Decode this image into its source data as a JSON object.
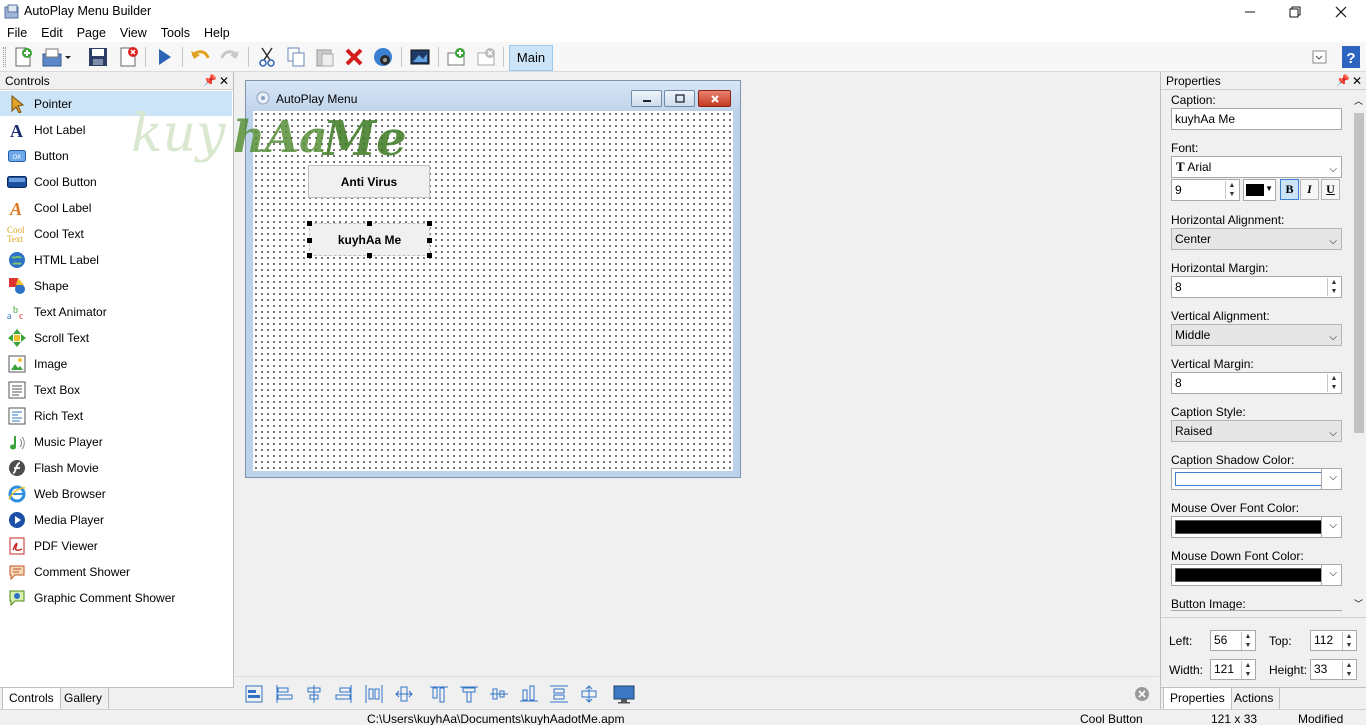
{
  "window": {
    "title": "AutoPlay Menu Builder"
  },
  "menu": [
    "File",
    "Edit",
    "Page",
    "View",
    "Tools",
    "Help"
  ],
  "toolbar": {
    "page_button": "Main"
  },
  "controls_panel": {
    "title": "Controls",
    "items": [
      {
        "label": "Pointer",
        "icon": "pointer-icon"
      },
      {
        "label": "Hot Label",
        "icon": "hot-label-icon"
      },
      {
        "label": "Button",
        "icon": "button-icon"
      },
      {
        "label": "Cool Button",
        "icon": "cool-button-icon"
      },
      {
        "label": "Cool Label",
        "icon": "cool-label-icon"
      },
      {
        "label": "Cool Text",
        "icon": "cool-text-icon"
      },
      {
        "label": "HTML Label",
        "icon": "html-label-icon"
      },
      {
        "label": "Shape",
        "icon": "shape-icon"
      },
      {
        "label": "Text Animator",
        "icon": "text-animator-icon"
      },
      {
        "label": "Scroll Text",
        "icon": "scroll-text-icon"
      },
      {
        "label": "Image",
        "icon": "image-icon"
      },
      {
        "label": "Text Box",
        "icon": "text-box-icon"
      },
      {
        "label": "Rich Text",
        "icon": "rich-text-icon"
      },
      {
        "label": "Music Player",
        "icon": "music-player-icon"
      },
      {
        "label": "Flash Movie",
        "icon": "flash-movie-icon"
      },
      {
        "label": "Web Browser",
        "icon": "web-browser-icon"
      },
      {
        "label": "Media Player",
        "icon": "media-player-icon"
      },
      {
        "label": "PDF Viewer",
        "icon": "pdf-viewer-icon"
      },
      {
        "label": "Comment Shower",
        "icon": "comment-shower-icon"
      },
      {
        "label": "Graphic Comment Shower",
        "icon": "graphic-comment-shower-icon"
      }
    ],
    "tabs": [
      "Controls",
      "Gallery"
    ]
  },
  "design_window": {
    "title": "AutoPlay Menu",
    "watermark": "kuyhAa Me",
    "buttons": [
      "Anti Virus",
      "kuyhAa Me"
    ]
  },
  "properties": {
    "title": "Properties",
    "caption_label": "Caption:",
    "caption_value": "kuyhAa Me",
    "font_label": "Font:",
    "font_value": "Arial",
    "font_size": "9",
    "bold": "B",
    "italic": "I",
    "underline": "U",
    "h_align_label": "Horizontal Alignment:",
    "h_align_value": "Center",
    "h_margin_label": "Horizontal Margin:",
    "h_margin_value": "8",
    "v_align_label": "Vertical Alignment:",
    "v_align_value": "Middle",
    "v_margin_label": "Vertical Margin:",
    "v_margin_value": "8",
    "caption_style_label": "Caption Style:",
    "caption_style_value": "Raised",
    "shadow_color_label": "Caption Shadow Color:",
    "mouse_over_label": "Mouse Over Font Color:",
    "mouse_down_label": "Mouse Down Font Color:",
    "button_image_label": "Button Image:",
    "left_label": "Left:",
    "left_value": "56",
    "top_label": "Top:",
    "top_value": "112",
    "width_label": "Width:",
    "width_value": "121",
    "height_label": "Height:",
    "height_value": "33",
    "tabs": [
      "Properties",
      "Actions"
    ]
  },
  "status": {
    "path": "C:\\Users\\kuyhAa\\Documents\\kuyhAadotMe.apm",
    "control": "Cool Button",
    "size": "121 x 33",
    "state": "Modified"
  },
  "colors": {
    "selection": "#cce4f7",
    "shadow_color": "#ffffff",
    "mouse_over_color": "#000000",
    "mouse_down_color": "#000000"
  }
}
